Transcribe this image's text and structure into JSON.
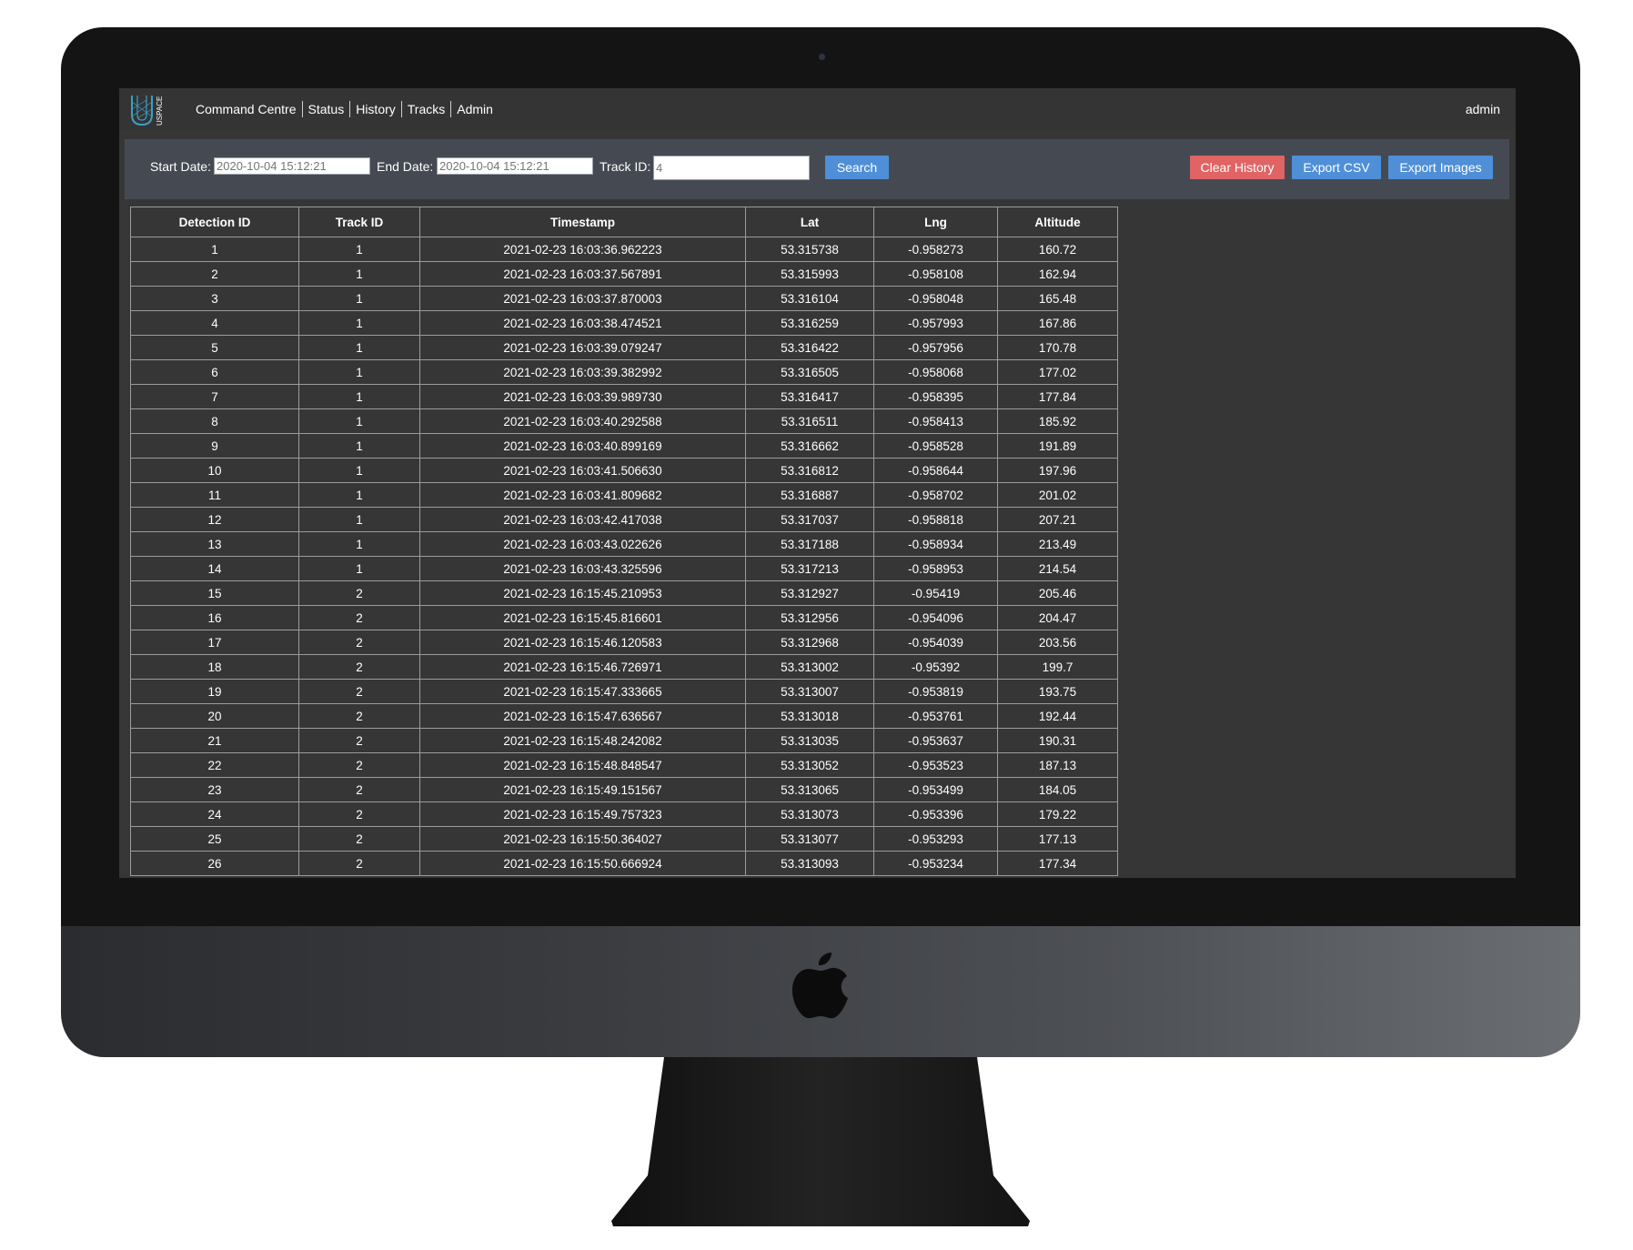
{
  "app": {
    "logo_text": "USPACE",
    "nav": [
      "Command Centre",
      "Status",
      "History",
      "Tracks",
      "Admin"
    ],
    "user": "admin"
  },
  "filters": {
    "start_label": "Start Date:",
    "start_placeholder": "2020-10-04 15:12:21",
    "end_label": "End Date:",
    "end_placeholder": "2020-10-04 15:12:21",
    "track_label": "Track ID:",
    "track_placeholder": "4",
    "search_label": "Search",
    "clear_label": "Clear History",
    "export_csv_label": "Export CSV",
    "export_images_label": "Export Images"
  },
  "table": {
    "columns": [
      "Detection ID",
      "Track ID",
      "Timestamp",
      "Lat",
      "Lng",
      "Altitude"
    ],
    "rows": [
      [
        "1",
        "1",
        "2021-02-23 16:03:36.962223",
        "53.315738",
        "-0.958273",
        "160.72"
      ],
      [
        "2",
        "1",
        "2021-02-23 16:03:37.567891",
        "53.315993",
        "-0.958108",
        "162.94"
      ],
      [
        "3",
        "1",
        "2021-02-23 16:03:37.870003",
        "53.316104",
        "-0.958048",
        "165.48"
      ],
      [
        "4",
        "1",
        "2021-02-23 16:03:38.474521",
        "53.316259",
        "-0.957993",
        "167.86"
      ],
      [
        "5",
        "1",
        "2021-02-23 16:03:39.079247",
        "53.316422",
        "-0.957956",
        "170.78"
      ],
      [
        "6",
        "1",
        "2021-02-23 16:03:39.382992",
        "53.316505",
        "-0.958068",
        "177.02"
      ],
      [
        "7",
        "1",
        "2021-02-23 16:03:39.989730",
        "53.316417",
        "-0.958395",
        "177.84"
      ],
      [
        "8",
        "1",
        "2021-02-23 16:03:40.292588",
        "53.316511",
        "-0.958413",
        "185.92"
      ],
      [
        "9",
        "1",
        "2021-02-23 16:03:40.899169",
        "53.316662",
        "-0.958528",
        "191.89"
      ],
      [
        "10",
        "1",
        "2021-02-23 16:03:41.506630",
        "53.316812",
        "-0.958644",
        "197.96"
      ],
      [
        "11",
        "1",
        "2021-02-23 16:03:41.809682",
        "53.316887",
        "-0.958702",
        "201.02"
      ],
      [
        "12",
        "1",
        "2021-02-23 16:03:42.417038",
        "53.317037",
        "-0.958818",
        "207.21"
      ],
      [
        "13",
        "1",
        "2021-02-23 16:03:43.022626",
        "53.317188",
        "-0.958934",
        "213.49"
      ],
      [
        "14",
        "1",
        "2021-02-23 16:03:43.325596",
        "53.317213",
        "-0.958953",
        "214.54"
      ],
      [
        "15",
        "2",
        "2021-02-23 16:15:45.210953",
        "53.312927",
        "-0.95419",
        "205.46"
      ],
      [
        "16",
        "2",
        "2021-02-23 16:15:45.816601",
        "53.312956",
        "-0.954096",
        "204.47"
      ],
      [
        "17",
        "2",
        "2021-02-23 16:15:46.120583",
        "53.312968",
        "-0.954039",
        "203.56"
      ],
      [
        "18",
        "2",
        "2021-02-23 16:15:46.726971",
        "53.313002",
        "-0.95392",
        "199.7"
      ],
      [
        "19",
        "2",
        "2021-02-23 16:15:47.333665",
        "53.313007",
        "-0.953819",
        "193.75"
      ],
      [
        "20",
        "2",
        "2021-02-23 16:15:47.636567",
        "53.313018",
        "-0.953761",
        "192.44"
      ],
      [
        "21",
        "2",
        "2021-02-23 16:15:48.242082",
        "53.313035",
        "-0.953637",
        "190.31"
      ],
      [
        "22",
        "2",
        "2021-02-23 16:15:48.848547",
        "53.313052",
        "-0.953523",
        "187.13"
      ],
      [
        "23",
        "2",
        "2021-02-23 16:15:49.151567",
        "53.313065",
        "-0.953499",
        "184.05"
      ],
      [
        "24",
        "2",
        "2021-02-23 16:15:49.757323",
        "53.313073",
        "-0.953396",
        "179.22"
      ],
      [
        "25",
        "2",
        "2021-02-23 16:15:50.364027",
        "53.313077",
        "-0.953293",
        "177.13"
      ],
      [
        "26",
        "2",
        "2021-02-23 16:15:50.666924",
        "53.313093",
        "-0.953234",
        "177.34"
      ]
    ]
  },
  "colors": {
    "screen_bg": "#363636",
    "filter_bg": "#454a52",
    "primary": "#4f8fd8",
    "danger": "#e06464",
    "logo": "#3aa0c8"
  }
}
